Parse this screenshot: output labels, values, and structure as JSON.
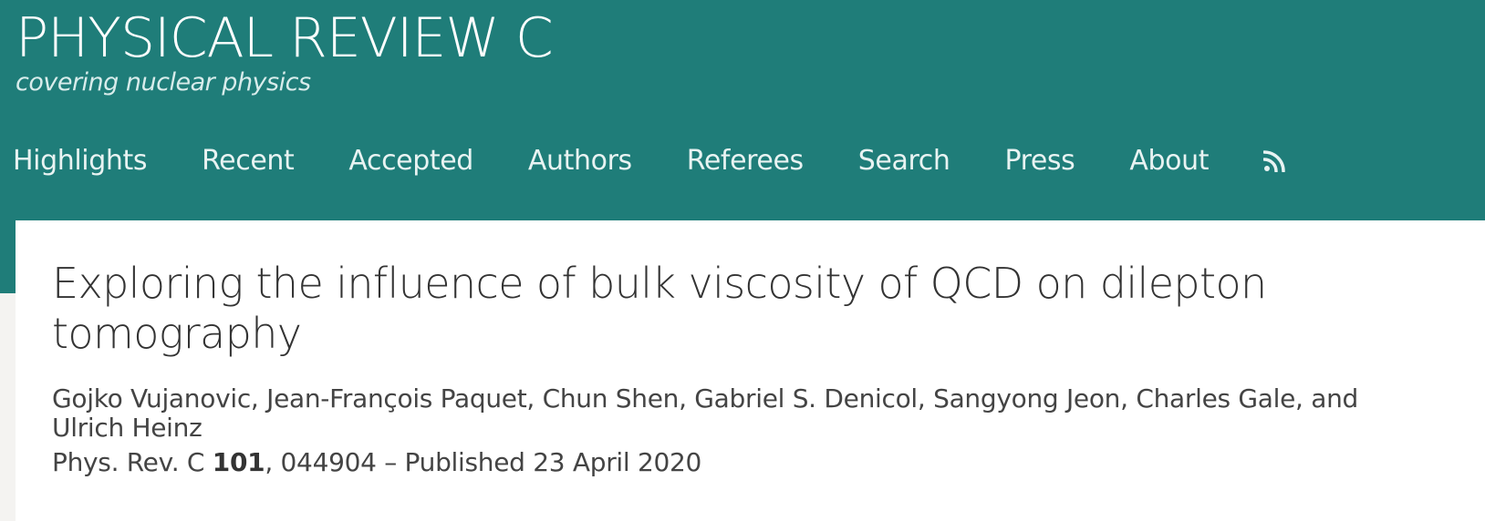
{
  "header": {
    "journal_title": "PHYSICAL REVIEW C",
    "subtitle": "covering nuclear physics",
    "background_color": "#1f7d79"
  },
  "nav": {
    "items": [
      {
        "label": "Highlights"
      },
      {
        "label": "Recent"
      },
      {
        "label": "Accepted"
      },
      {
        "label": "Authors"
      },
      {
        "label": "Referees"
      },
      {
        "label": "Search"
      },
      {
        "label": "Press"
      },
      {
        "label": "About"
      }
    ],
    "rss_icon": "rss-icon"
  },
  "article": {
    "title": "Exploring the influence of bulk viscosity of QCD on dilepton tomography",
    "authors": "Gojko Vujanovic, Jean-François Paquet, Chun Shen, Gabriel S. Denicol, Sangyong Jeon, Charles Gale, and Ulrich Heinz",
    "citation": {
      "journal": "Phys. Rev. C",
      "volume": "101",
      "article_number": ", 044904",
      "published": " – Published 23 April 2020"
    }
  }
}
